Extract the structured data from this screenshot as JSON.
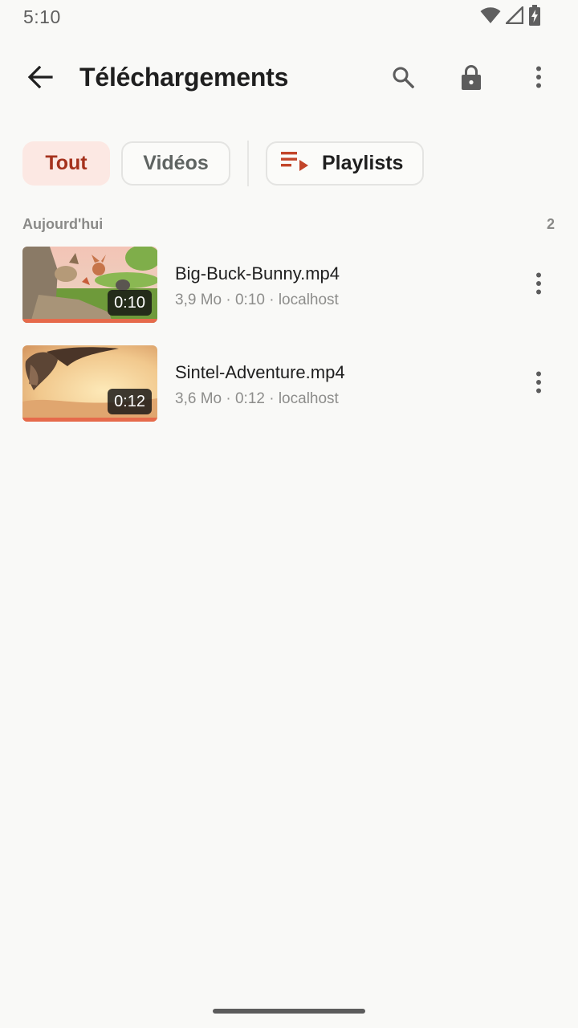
{
  "status_bar": {
    "time": "5:10",
    "icons": [
      "wifi-icon",
      "cellular-signal-icon",
      "battery-charging-icon"
    ]
  },
  "app_bar": {
    "title": "Téléchargements",
    "actions": [
      "search-icon",
      "lock-icon",
      "more-vert-icon"
    ]
  },
  "filters": {
    "chips": [
      {
        "label": "Tout",
        "selected": true
      },
      {
        "label": "Vidéos",
        "selected": false
      },
      {
        "label": "Playlists",
        "selected": false,
        "icon": "playlist-play-icon"
      }
    ]
  },
  "section": {
    "title": "Aujourd'hui",
    "count": "2"
  },
  "videos": [
    {
      "title": "Big-Buck-Bunny.mp4",
      "meta": "3,9 Mo · 0:10 · localhost",
      "duration": "0:10",
      "progress": 1.0
    },
    {
      "title": "Sintel-Adventure.mp4",
      "meta": "3,6 Mo · 0:12 · localhost",
      "duration": "0:12",
      "progress": 1.0
    }
  ],
  "colors": {
    "accent": "#a5321d",
    "accent_bg": "#fce8e3",
    "progress": "#e66a4b",
    "background": "#f9f9f7"
  }
}
